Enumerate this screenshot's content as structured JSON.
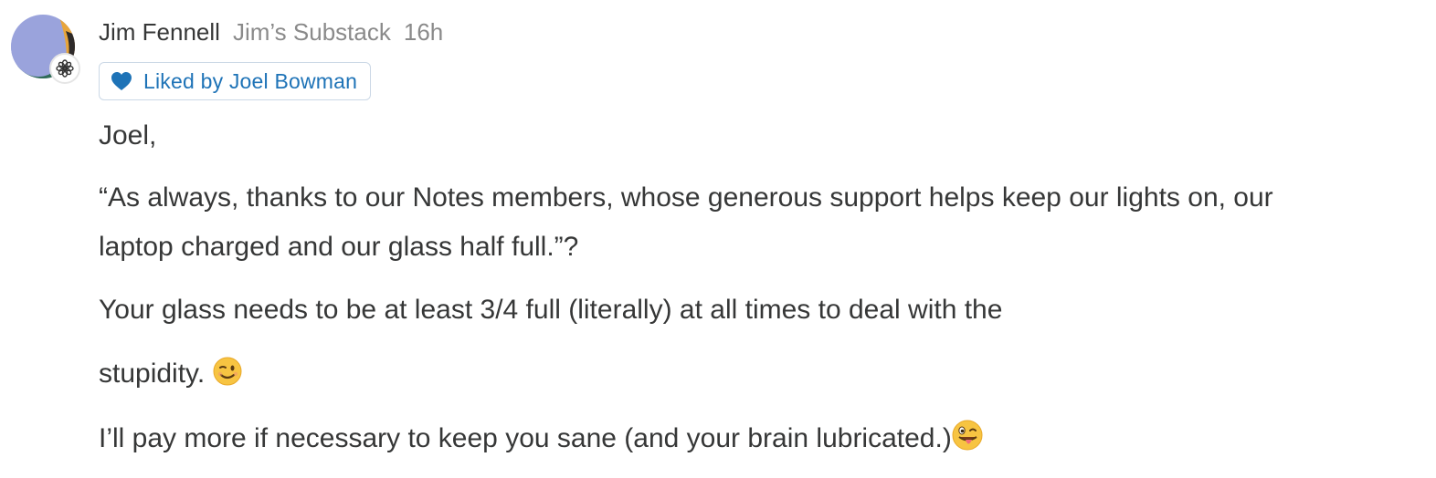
{
  "note": {
    "author": "Jim Fennell",
    "publication": "Jim’s Substack",
    "time": "16h",
    "liked_by": "Liked by Joel Bowman",
    "avatar_icon": "user-avatar",
    "publication_icon": "flower-icon",
    "like_icon": "heart-icon",
    "accent_color": "#1e73b7",
    "body": {
      "p1": "Joel,",
      "p2_line1": "“As always, thanks to our Notes members, whose generous support helps keep our lights on, our",
      "p2_line2": "laptop charged and our glass half full.”?",
      "p3": "Your glass needs to be at least 3/4 full (literally) at all times to deal with the",
      "p4": "stupidity. ",
      "p5": "I’ll pay more if necessary to keep you sane (and your brain lubricated.)"
    },
    "emojis": {
      "wink": "winking-face-emoji",
      "zany": "winking-face-with-tongue-emoji"
    }
  }
}
